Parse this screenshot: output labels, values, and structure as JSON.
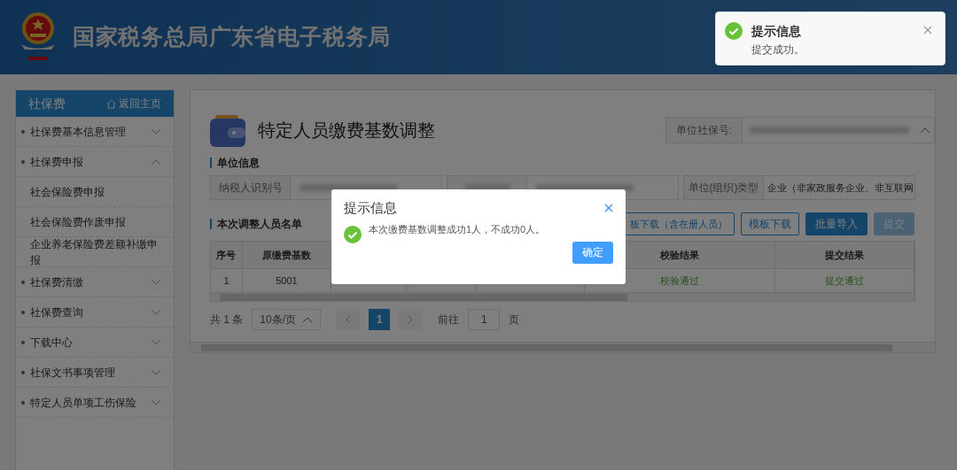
{
  "header": {
    "title": "国家税务总局广东省电子税务局"
  },
  "sidebar": {
    "title": "社保费",
    "home_link": "返回主页",
    "items": [
      {
        "label": "社保费基本信息管理",
        "kind": "group",
        "expanded": false
      },
      {
        "label": "社保费申报",
        "kind": "group",
        "expanded": true
      },
      {
        "label": "社会保险费申报",
        "kind": "sub"
      },
      {
        "label": "社会保险费作废申报",
        "kind": "sub"
      },
      {
        "label": "企业养老保险费差额补缴申报",
        "kind": "sub"
      },
      {
        "label": "社保费清缴",
        "kind": "group",
        "expanded": false
      },
      {
        "label": "社保费查询",
        "kind": "group",
        "expanded": false
      },
      {
        "label": "下载中心",
        "kind": "group",
        "expanded": false
      },
      {
        "label": "社保文书事项管理",
        "kind": "group",
        "expanded": false
      },
      {
        "label": "特定人员单项工伤保险",
        "kind": "group",
        "expanded": false
      }
    ]
  },
  "page": {
    "title": "特定人员缴费基数调整",
    "unit_selector": {
      "label": "单位社保号:"
    },
    "unit_info": {
      "heading": "单位信息",
      "fields": [
        {
          "label": "纳税人识别号"
        },
        {
          "label": "单位(组织)类型",
          "value": "企业（非家政服务企业、非互联网"
        }
      ]
    },
    "list": {
      "heading": "本次调整人员名单",
      "buttons": [
        {
          "label": "板下载（含在册人员）",
          "kind": "outline"
        },
        {
          "label": "模板下载",
          "kind": "outline"
        },
        {
          "label": "批量导入",
          "kind": "primary",
          "disabled": false
        },
        {
          "label": "提交",
          "kind": "primary",
          "disabled": true
        }
      ],
      "columns": [
        "序号",
        "原缴费基数",
        "校验结果",
        "提交结果"
      ],
      "rows": [
        [
          "1",
          "5001",
          "校验通过",
          "提交通过"
        ]
      ]
    },
    "pagination": {
      "total": "共 1 条",
      "page_size": "10条/页",
      "pages": [
        {
          "label": "1",
          "selected": true
        }
      ],
      "goto_label": "前往",
      "goto_value": "1",
      "goto_suffix": "页"
    }
  },
  "dialog": {
    "title": "提示信息",
    "message": "本次缴费基数调整成功1人，不成功0人。",
    "button": "确定"
  },
  "toast": {
    "title": "提示信息",
    "message": "提交成功。"
  }
}
